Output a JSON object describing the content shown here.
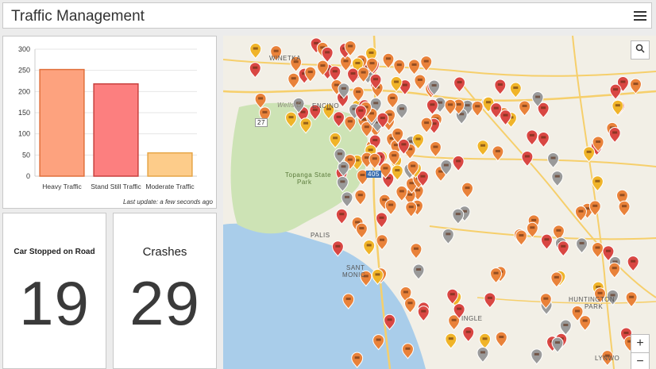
{
  "header": {
    "title": "Traffic Management",
    "menu_icon": "hamburger-menu-icon"
  },
  "chart_data": {
    "type": "bar",
    "categories": [
      "Heavy Traffic",
      "Stand Still Traffic",
      "Moderate Traffic"
    ],
    "values": [
      252,
      218,
      55
    ],
    "colors": [
      "#fda27e",
      "#fc7f7f",
      "#fdcc8a"
    ],
    "stroke_colors": [
      "#e0703c",
      "#c8413e",
      "#e6a546"
    ],
    "ylim": [
      0,
      300
    ],
    "yticks": [
      0,
      50,
      100,
      150,
      200,
      250,
      300
    ],
    "grid": true
  },
  "chart_footer": {
    "update_text": "Last update: a few seconds ago"
  },
  "metrics": [
    {
      "label": "Car Stopped on Road",
      "value": "19"
    },
    {
      "label": "Crashes",
      "value": "29"
    }
  ],
  "map": {
    "labels": {
      "winnetka": "WINETKA",
      "encino": "ENCINO",
      "topanga": "Topanga State",
      "park": "Park",
      "palisades": "PALIS",
      "santa_monica_1": "SANT",
      "santa_monica_2": "MONIC",
      "huntington_1": "HUNTINGTON",
      "huntington_2": "PARK",
      "lynwood": "LYNWO",
      "inglewood": "INGLE",
      "wells": "Wells Dr",
      "route27": "27",
      "route405": "405"
    },
    "controls": {
      "search_icon": "search-icon",
      "zoom_in": "+",
      "zoom_out": "−"
    },
    "colors": {
      "ocean": "#a9cdea",
      "park": "#cde3b5",
      "land": "#f2efe6",
      "road": "#f6cf6b",
      "pin_orange": "#e9823a",
      "pin_red": "#d94743",
      "pin_yellow": "#f0b429",
      "pin_gray": "#9a9a9a"
    }
  }
}
